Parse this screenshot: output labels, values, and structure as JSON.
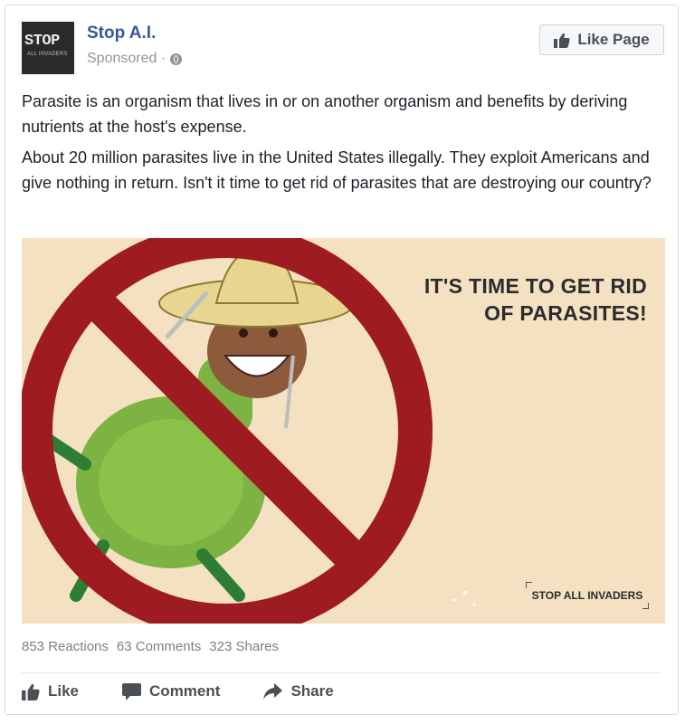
{
  "page": {
    "name": "Stop A.I.",
    "sponsored_label": "Sponsored ·",
    "logo_text": "STOP",
    "logo_subtext": "ALL INVADERS",
    "like_page_label": "Like Page"
  },
  "post": {
    "paragraphs": [
      "Parasite is an organism that lives in or on another organism and benefits by deriving nutrients at the host's expense.",
      "About 20 million parasites live in the United States illegally. They exploit Americans and give nothing in return. Isn't it time to get rid of parasites that are destroying our country?"
    ]
  },
  "image": {
    "headline_line1": "IT'S TIME TO GET RID",
    "headline_line2": "OF PARASITES!",
    "tag": "STOP ALL INVADERS",
    "colors": {
      "background": "#f3e1c2",
      "ban_red": "#9e1b22",
      "bug_green": "#6aa84f",
      "hat": "#e8d690"
    }
  },
  "stats": {
    "reactions": "853 Reactions",
    "comments": "63 Comments",
    "shares": "323 Shares"
  },
  "actions": {
    "like": "Like",
    "comment": "Comment",
    "share": "Share"
  },
  "icons": [
    "globe-icon",
    "thumbs-up-icon",
    "comment-icon",
    "share-icon"
  ]
}
